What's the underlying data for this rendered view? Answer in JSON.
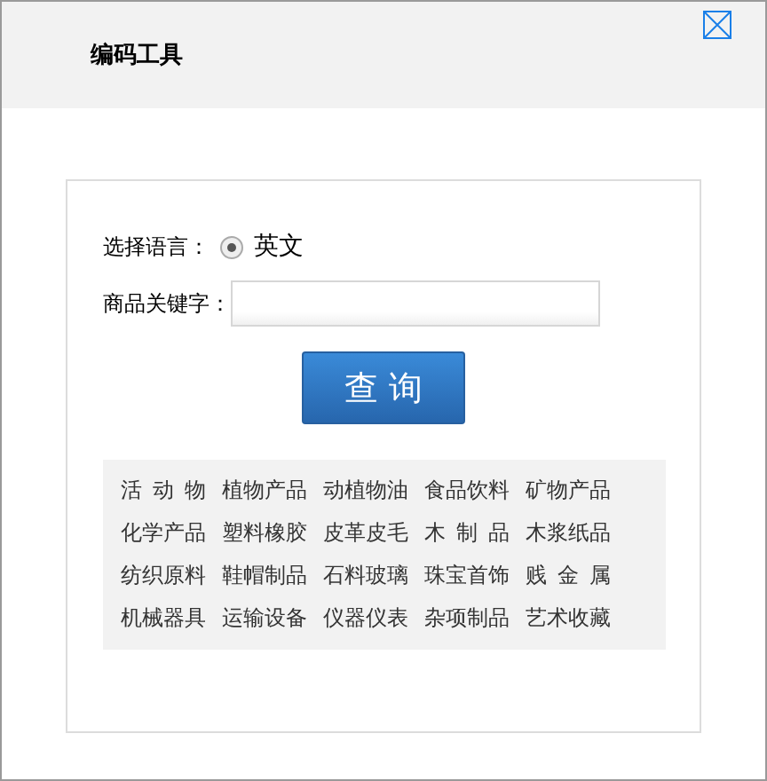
{
  "dialog": {
    "title": "编码工具"
  },
  "form": {
    "language_label": "选择语言：",
    "languages": [
      {
        "label": "英文",
        "selected": true
      }
    ],
    "keyword_label": "商品关键字：",
    "search_button": "查 询"
  },
  "categories": [
    {
      "label": "活动物"
    },
    {
      "label": "植物产品"
    },
    {
      "label": "动植物油"
    },
    {
      "label": "食品饮料"
    },
    {
      "label": "矿物产品"
    },
    {
      "label": "化学产品"
    },
    {
      "label": "塑料橡胶"
    },
    {
      "label": "皮革皮毛"
    },
    {
      "label": "木制品"
    },
    {
      "label": "木浆纸品"
    },
    {
      "label": "纺织原料"
    },
    {
      "label": "鞋帽制品"
    },
    {
      "label": "石料玻璃"
    },
    {
      "label": "珠宝首饰"
    },
    {
      "label": "贱金属"
    },
    {
      "label": "机械器具"
    },
    {
      "label": "运输设备"
    },
    {
      "label": "仪器仪表"
    },
    {
      "label": "杂项制品"
    },
    {
      "label": "艺术收藏"
    }
  ]
}
